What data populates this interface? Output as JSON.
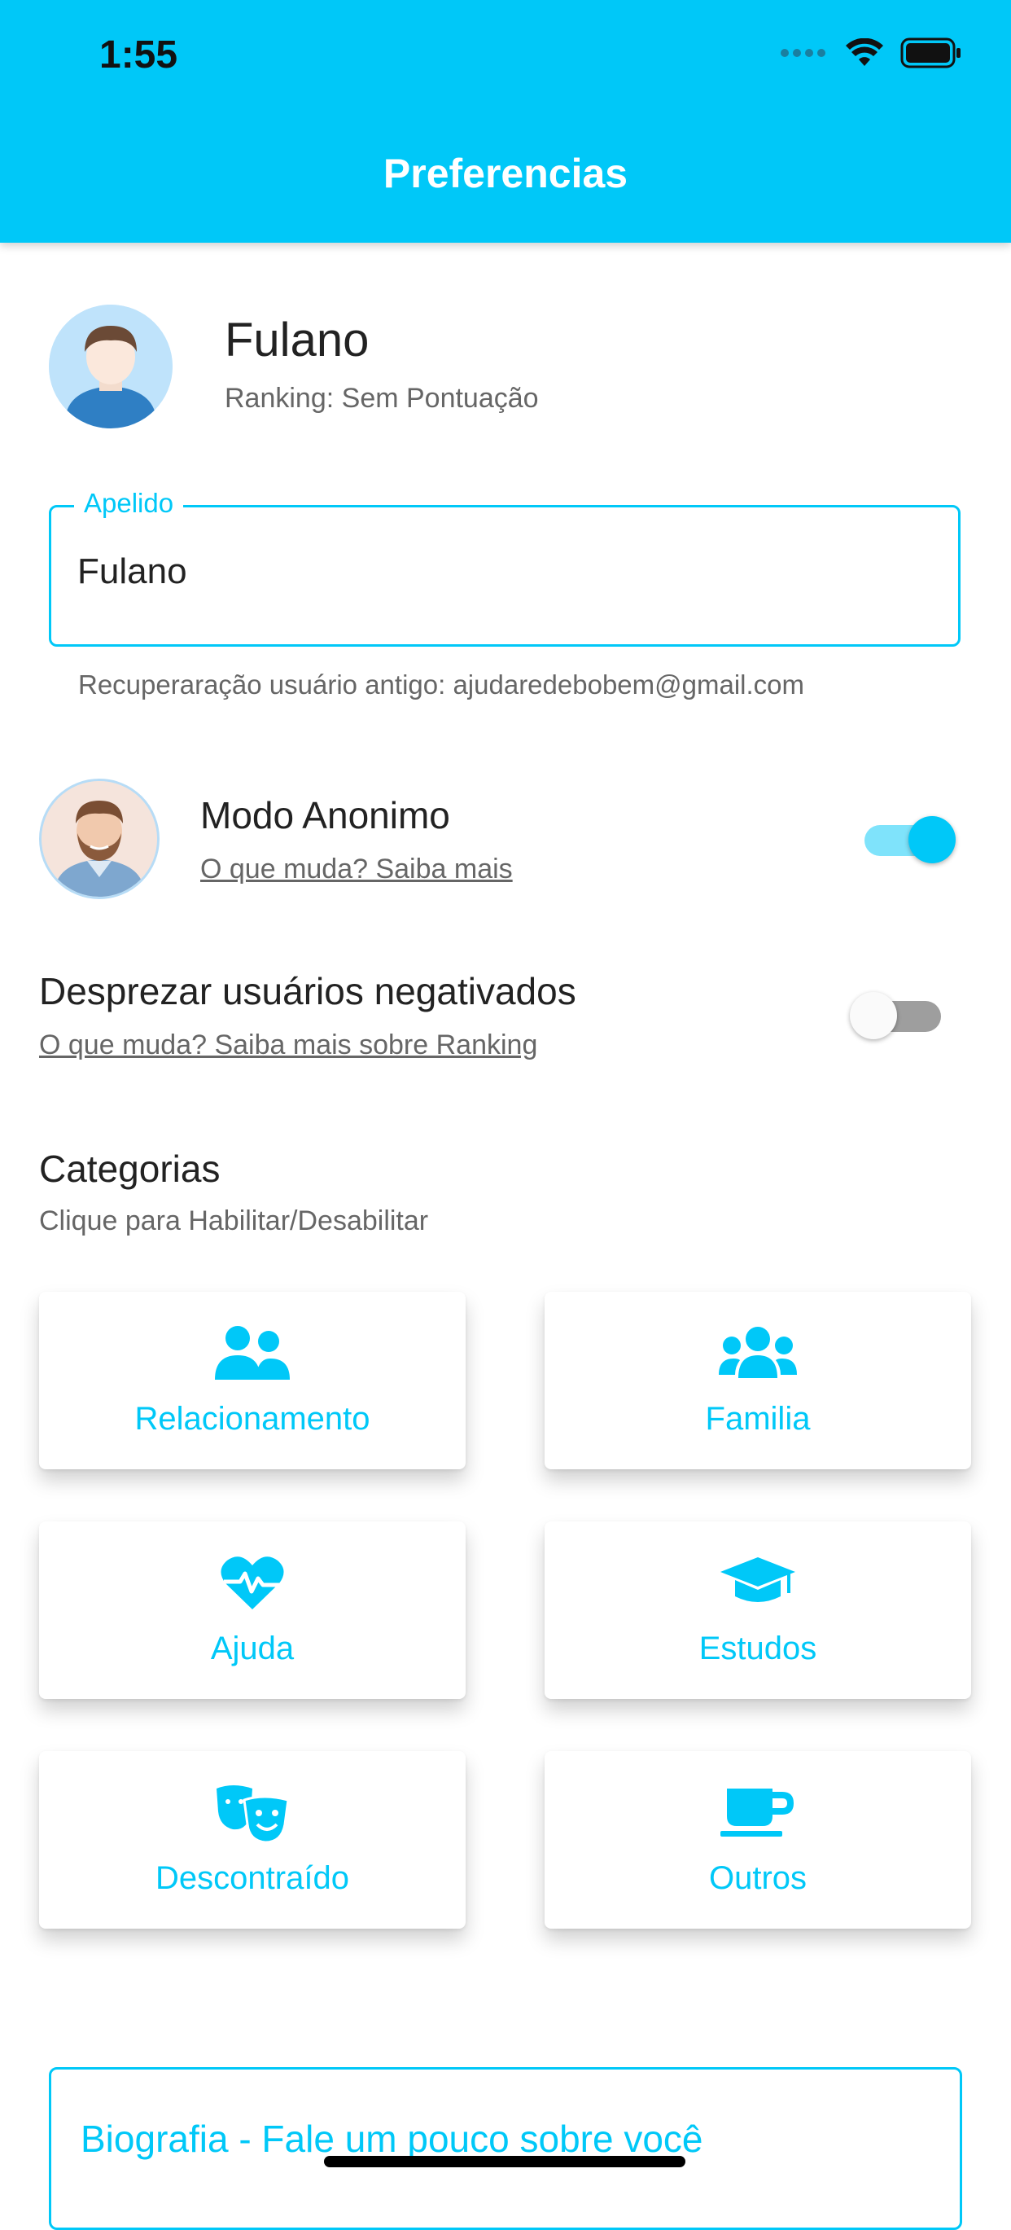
{
  "status_bar": {
    "time": "1:55"
  },
  "header": {
    "title": "Preferencias"
  },
  "profile": {
    "name": "Fulano",
    "ranking": "Ranking: Sem Pontuação"
  },
  "nickname": {
    "label": "Apelido",
    "value": "Fulano"
  },
  "recovery_text": "Recuperaração usuário antigo: ajudaredebobem@gmail.com",
  "anonymous_mode": {
    "title": "Modo Anonimo",
    "link": "O que muda? Saiba mais",
    "enabled": true
  },
  "ignore_negative": {
    "title": "Desprezar usuários negativados",
    "link": "O que muda? Saiba mais sobre Ranking",
    "enabled": false
  },
  "categories": {
    "title": "Categorias",
    "subtitle": "Clique para Habilitar/Desabilitar",
    "items": [
      {
        "label": "Relacionamento",
        "icon": "user-friends-icon"
      },
      {
        "label": "Familia",
        "icon": "users-icon"
      },
      {
        "label": "Ajuda",
        "icon": "heartbeat-icon"
      },
      {
        "label": "Estudos",
        "icon": "graduation-cap-icon"
      },
      {
        "label": "Descontraído",
        "icon": "theater-masks-icon"
      },
      {
        "label": "Outros",
        "icon": "coffee-icon"
      }
    ]
  },
  "biography": {
    "label": "Biografia - Fale um pouco sobre você"
  },
  "colors": {
    "accent": "#00c8f8",
    "text": "#222222",
    "secondary_text": "#666666"
  }
}
